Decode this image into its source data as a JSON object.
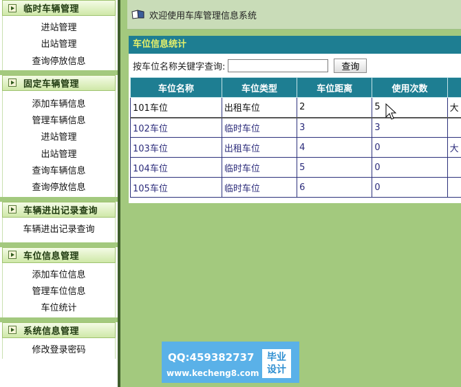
{
  "sidebar": {
    "sections": [
      {
        "title": "临时车辆管理",
        "items": [
          "进站管理",
          "出站管理",
          "查询停放信息"
        ]
      },
      {
        "title": "固定车辆管理",
        "items": [
          "添加车辆信息",
          "管理车辆信息",
          "进站管理",
          "出站管理",
          "查询车辆信息",
          "查询停放信息"
        ]
      },
      {
        "title": "车辆进出记录查询",
        "items": [
          "车辆进出记录查询"
        ]
      },
      {
        "title": "车位信息管理",
        "items": [
          "添加车位信息",
          "管理车位信息",
          "车位统计"
        ]
      },
      {
        "title": "系统信息管理",
        "items": [
          "修改登录密码"
        ]
      }
    ]
  },
  "header": {
    "welcome": "欢迎使用车库管理信息系统"
  },
  "panel": {
    "title": "车位信息统计",
    "search_label": "按车位名称关键字查询:",
    "search_value": "",
    "search_button": "查询",
    "columns": [
      "车位名称",
      "车位类型",
      "车位距离",
      "使用次数",
      ""
    ],
    "rows": [
      [
        "101车位",
        "出租车位",
        "2",
        "5",
        "大"
      ],
      [
        "102车位",
        "临时车位",
        "3",
        "3",
        ""
      ],
      [
        "103车位",
        "出租车位",
        "4",
        "0",
        "大"
      ],
      [
        "104车位",
        "临时车位",
        "5",
        "0",
        ""
      ],
      [
        "105车位",
        "临时车位",
        "6",
        "0",
        ""
      ]
    ]
  },
  "watermark": {
    "qq": "QQ:459382737",
    "site": "www.kecheng8.com",
    "badge_line1": "毕业",
    "badge_line2": "设计"
  }
}
